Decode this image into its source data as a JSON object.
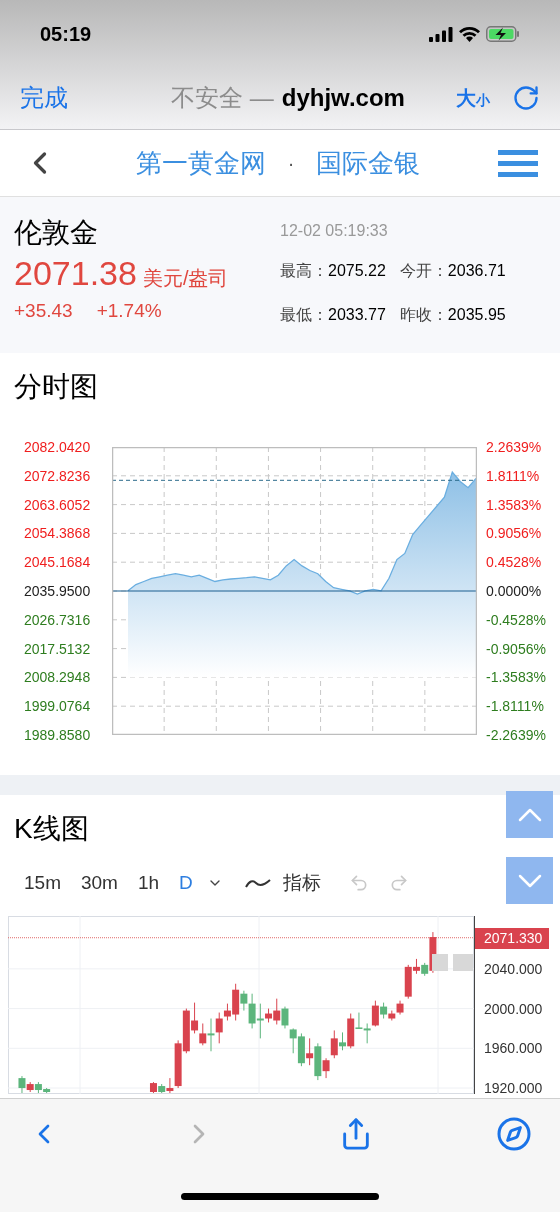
{
  "status_bar": {
    "time": "05:19"
  },
  "browser_bar": {
    "done": "完成",
    "security": "不安全 —",
    "domain": "dyhjw.com",
    "text_size_large": "大",
    "text_size_small": "小"
  },
  "site_nav": {
    "site": "第一黄金网",
    "separator": "·",
    "section": "国际金银"
  },
  "quote": {
    "name": "伦敦金",
    "time": "12-02 05:19:33",
    "price": "2071.38",
    "unit": "美元/盎司",
    "change": "+35.43",
    "change_pct": "+1.74%",
    "stats": [
      {
        "label": "最高：",
        "value": "2075.22"
      },
      {
        "label": "今开：",
        "value": "2036.71"
      },
      {
        "label": "最低：",
        "value": "2033.77"
      },
      {
        "label": "昨收：",
        "value": "2035.95"
      }
    ]
  },
  "intraday": {
    "title": "分时图",
    "chart_data": {
      "type": "area",
      "ylim": [
        1989.858,
        2082.042
      ],
      "yticks": [
        {
          "value": 2082.042,
          "label": "2082.0420"
        },
        {
          "value": 2072.8236,
          "label": "2072.8236"
        },
        {
          "value": 2063.6052,
          "label": "2063.6052"
        },
        {
          "value": 2054.3868,
          "label": "2054.3868"
        },
        {
          "value": 2045.1684,
          "label": "2045.1684"
        },
        {
          "value": 2035.95,
          "label": "2035.9500"
        },
        {
          "value": 2026.7316,
          "label": "2026.7316"
        },
        {
          "value": 2017.5132,
          "label": "2017.5132"
        },
        {
          "value": 2008.2948,
          "label": "2008.2948"
        },
        {
          "value": 1999.0764,
          "label": "1999.0764"
        },
        {
          "value": 1989.858,
          "label": "1989.8580"
        }
      ],
      "series": [
        {
          "color": "#6aaee0",
          "values": [
            2036,
            2038,
            2039,
            2040,
            2040.5,
            2041,
            2041.5,
            2041,
            2040.5,
            2041,
            2040,
            2039,
            2039.5,
            2039.8,
            2040,
            2040.2,
            2040.5,
            2040,
            2039.5,
            2041,
            2044,
            2046,
            2044,
            2042.5,
            2041.5,
            2039,
            2037,
            2036.5,
            2036,
            2035,
            2036,
            2036.5,
            2036,
            2040,
            2046,
            2048,
            2054,
            2057,
            2060,
            2063,
            2066,
            2074,
            2071,
            2069,
            2072
          ]
        }
      ],
      "grid": true,
      "ref_lines": [
        {
          "axis": "y",
          "value": 2035.95
        },
        {
          "axis": "y",
          "value": 2071.38
        }
      ]
    },
    "percent_labels": [
      {
        "text": "2.2639%",
        "kind": "up"
      },
      {
        "text": "1.8111%",
        "kind": "up"
      },
      {
        "text": "1.3583%",
        "kind": "up"
      },
      {
        "text": "0.9056%",
        "kind": "up"
      },
      {
        "text": "0.4528%",
        "kind": "up"
      },
      {
        "text": "0.0000%",
        "kind": "flat"
      },
      {
        "text": "-0.4528%",
        "kind": "down"
      },
      {
        "text": "-0.9056%",
        "kind": "down"
      },
      {
        "text": "-1.3583%",
        "kind": "down"
      },
      {
        "text": "-1.8111%",
        "kind": "down"
      },
      {
        "text": "-2.2639%",
        "kind": "down"
      }
    ]
  },
  "kline": {
    "title": "K线图",
    "intervals": [
      {
        "label": "15m",
        "selected": false
      },
      {
        "label": "30m",
        "selected": false
      },
      {
        "label": "1h",
        "selected": false
      },
      {
        "label": "D",
        "selected": true
      }
    ],
    "indicator": "指标",
    "undo_disabled": true,
    "redo_disabled": true,
    "last_price": "2071.330",
    "chart_data": {
      "type": "candlestick",
      "ylim": [
        1914,
        2093.2
      ],
      "grid": true,
      "ref_lines": [
        {
          "axis": "y",
          "value": 2071.33
        }
      ],
      "yticks": [
        {
          "value": 2040,
          "label": "2040.000"
        },
        {
          "value": 2000,
          "label": "2000.000"
        },
        {
          "value": 1960,
          "label": "1960.000"
        },
        {
          "value": 1920,
          "label": "1920.000"
        }
      ],
      "categories": [
        null,
        null,
        null,
        null,
        null,
        null,
        null,
        null,
        null,
        null,
        null,
        null,
        null,
        null,
        null,
        null,
        null,
        null,
        null,
        null,
        null,
        null,
        null,
        null,
        null,
        null,
        null,
        null,
        null,
        null,
        null,
        null,
        null,
        null,
        null,
        null,
        null,
        null,
        null,
        null,
        null,
        null,
        null,
        null,
        null,
        null,
        null,
        null,
        null,
        null,
        null
      ],
      "ohlc": [
        [
          1930,
          1932,
          1915,
          1920
        ],
        [
          1918,
          1926,
          1916,
          1924
        ],
        [
          1924,
          1926,
          1915,
          1918
        ],
        [
          1919,
          1920,
          1915,
          1916
        ],
        null,
        null,
        null,
        null,
        null,
        null,
        null,
        null,
        null,
        null,
        null,
        null,
        [
          1916,
          1926,
          1915,
          1925
        ],
        [
          1922,
          1924,
          1915,
          1916
        ],
        [
          1917,
          1930,
          1915,
          1920
        ],
        [
          1922,
          1968,
          1920,
          1965
        ],
        [
          1957,
          2000,
          1955,
          1998
        ],
        [
          1978,
          2006,
          1975,
          1988
        ],
        [
          1965,
          1985,
          1963,
          1975
        ],
        [
          1975,
          1990,
          1957,
          1973
        ],
        [
          1976,
          1996,
          1965,
          1990
        ],
        [
          1992,
          2005,
          1988,
          1998
        ],
        [
          1994,
          2025,
          1988,
          2019
        ],
        [
          2015,
          2018,
          1998,
          2005
        ],
        [
          2005,
          2015,
          1980,
          1985
        ],
        [
          1990,
          2005,
          1970,
          1988
        ],
        [
          1990,
          2000,
          1986,
          1995
        ],
        [
          1988,
          2010,
          1984,
          1998
        ],
        [
          2000,
          2002,
          1980,
          1983
        ],
        [
          1979,
          1980,
          1955,
          1970
        ],
        [
          1972,
          1975,
          1942,
          1945
        ],
        [
          1950,
          1970,
          1943,
          1955
        ],
        [
          1962,
          1965,
          1928,
          1932
        ],
        [
          1937,
          1950,
          1930,
          1948
        ],
        [
          1953,
          1978,
          1950,
          1970
        ],
        [
          1966,
          1976,
          1958,
          1962
        ],
        [
          1962,
          1995,
          1960,
          1990
        ],
        [
          1981,
          1996,
          1980,
          1980
        ],
        [
          1980,
          1985,
          1965,
          1978
        ],
        [
          1983,
          2008,
          1982,
          2003
        ],
        [
          2002,
          2006,
          1990,
          1994
        ],
        [
          1990,
          1998,
          1988,
          1995
        ],
        [
          1996,
          2008,
          1994,
          2005
        ],
        [
          2012,
          2044,
          2010,
          2042
        ],
        [
          2038,
          2050,
          2035,
          2042
        ],
        [
          2044,
          2046,
          2033,
          2035
        ],
        [
          2038,
          2077,
          2036,
          2072
        ]
      ]
    }
  },
  "toolbar": {
    "back_disabled": false,
    "forward_disabled": true
  }
}
